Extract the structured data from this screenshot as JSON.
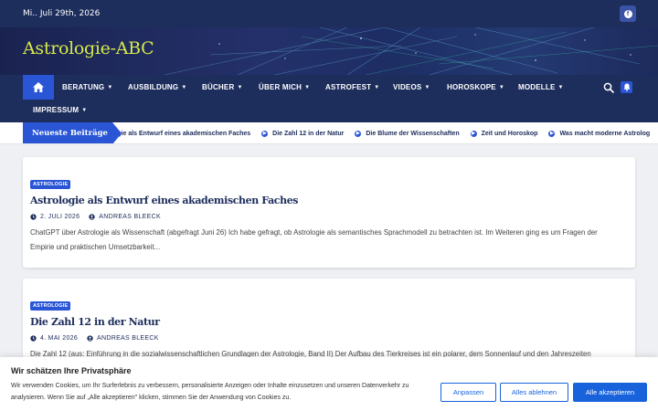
{
  "topbar": {
    "date": "Mi.. Juli 29th, 2026"
  },
  "site": {
    "title": "Astrologie-ABC"
  },
  "nav": {
    "items": [
      {
        "label": "BERATUNG"
      },
      {
        "label": "AUSBILDUNG"
      },
      {
        "label": "BÜCHER"
      },
      {
        "label": "ÜBER MICH"
      },
      {
        "label": "ASTROFEST"
      },
      {
        "label": "VIDEOS"
      },
      {
        "label": "HOROSKOPE"
      },
      {
        "label": "MODELLE"
      },
      {
        "label": "IMPRESSUM"
      }
    ]
  },
  "ticker": {
    "label": "Neueste Beiträge",
    "items": [
      "ogie als Entwurf eines akademischen Faches",
      "Die Zahl 12 in der Natur",
      "Die Blume der Wissenschaften",
      "Zeit und Horoskop",
      "Was macht moderne Astrolog"
    ]
  },
  "posts": [
    {
      "category": "ASTROLOGIE",
      "title": "Astrologie als Entwurf eines akademischen Faches",
      "date": "2. JULI 2026",
      "author": "ANDREAS BLEECK",
      "excerpt_line1": "ChatGPT über Astrologie als Wissenschaft (abgefragt Juni 26) Ich habe gefragt, ob Astrologie als semantisches Sprachmodell zu betrachten ist. Im Weiteren ging es um Fragen der",
      "excerpt_line2": "Empirie und praktischen Umsetzbarkeit..."
    },
    {
      "category": "ASTROLOGIE",
      "title": "Die Zahl 12 in der Natur",
      "date": "4. MAI 2026",
      "author": "ANDREAS BLEECK",
      "excerpt_line1": "Die Zahl 12 (aus: Einführung in die sozialwissenschaftlichen Grundlagen der Astrologie, Band II) Der Aufbau des Tierkreises ist ein polarer, dem Sonnenlauf und den Jahreszeiten"
    }
  ],
  "cookie": {
    "title": "Wir schätzen Ihre Privatsphäre",
    "text": "Wir verwenden Cookies, um Ihr Surferlebnis zu verbessern, personalisierte Anzeigen oder Inhalte einzusetzen und unseren Datenverkehr zu analysieren. Wenn Sie auf „Alle akzeptieren\" klicken, stimmen Sie der Anwendung von Cookies zu.",
    "btn_customize": "Anpassen",
    "btn_reject": "Alles ablehnen",
    "btn_accept": "Alle akzeptieren"
  },
  "colors": {
    "navy": "#1d2d5c",
    "accent": "#2a56d6",
    "title_yellow": "#d7ea4a",
    "cookie_blue": "#1863dc"
  },
  "icons": {
    "social": "facebook-icon",
    "home": "home-icon",
    "search": "search-icon",
    "notify": "bell-icon",
    "ticker": "arrow-circle-icon",
    "date": "clock-icon",
    "author": "user-icon"
  }
}
